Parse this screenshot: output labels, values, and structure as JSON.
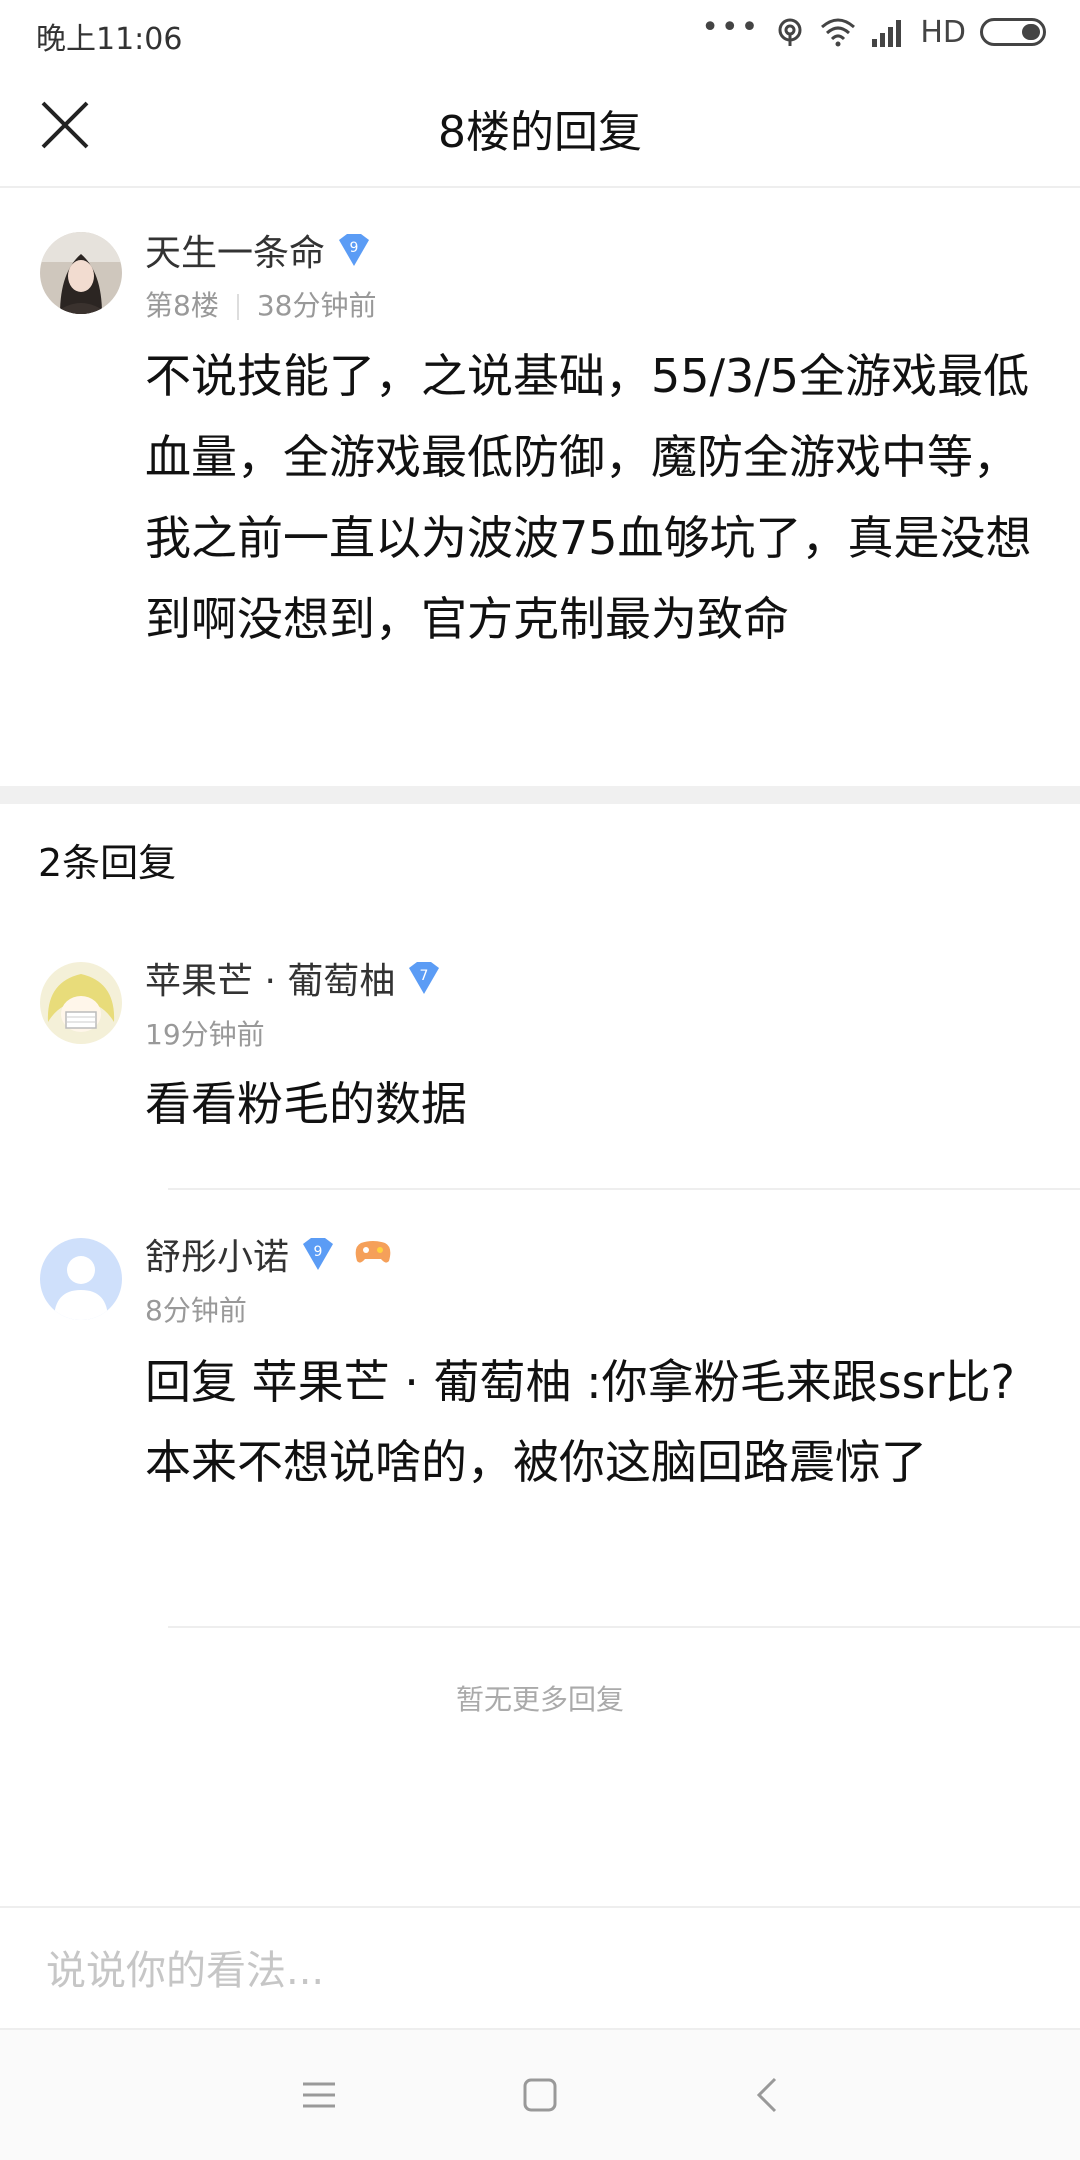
{
  "status_bar": {
    "time": "晚上11:06",
    "dots": "•••",
    "network": "HD"
  },
  "header": {
    "title": "8楼的回复",
    "close_icon": "close-icon"
  },
  "post": {
    "username": "天生一条命",
    "vip_level": "9",
    "floor": "第8楼",
    "time": "38分钟前",
    "content": "不说技能了，之说基础，55/3/5全游戏最低血量，全游戏最低防御，魔防全游戏中等，我之前一直以为波波75血够坑了，真是没想到啊没想到，官方克制最为致命"
  },
  "replies": {
    "count_label": "2条回复",
    "items": [
      {
        "username": "苹果芒 · 葡萄柚",
        "vip_level": "7",
        "time": "19分钟前",
        "content": "看看粉毛的数据"
      },
      {
        "username": "舒彤小诺",
        "vip_level": "9",
        "time": "8分钟前",
        "content": "回复 苹果芒 · 葡萄柚 :你拿粉毛来跟ssr比? 本来不想说啥的，被你这脑回路震惊了"
      }
    ],
    "no_more": "暂无更多回复"
  },
  "input": {
    "placeholder": "说说你的看法..."
  },
  "colors": {
    "vip_blue": "#5b9cf5",
    "game_badge_orange": "#f5a05a"
  }
}
